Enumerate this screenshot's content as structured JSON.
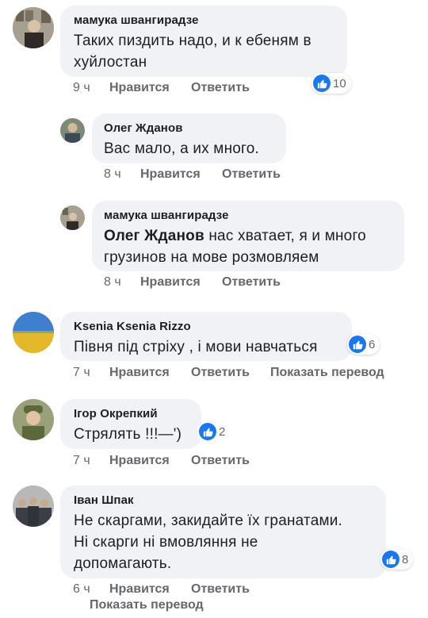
{
  "comments": [
    {
      "author": "мамука швангирадзе",
      "text": "Таких пиздить надо, и к ебеням в хуйлостан",
      "time": "9 ч",
      "like_label": "Нравится",
      "reply_label": "Ответить",
      "reactions": "10",
      "reaction_icon": "like-icon"
    },
    {
      "author": "Олег Жданов",
      "text": "Вас мало, а их много.",
      "time": "8 ч",
      "like_label": "Нравится",
      "reply_label": "Ответить"
    },
    {
      "author": "мамука швангирадзе",
      "mention": "Олег Жданов",
      "text": " нас хватает, я и много грузинов на мове  розмовляем",
      "time": "8 ч",
      "like_label": "Нравится",
      "reply_label": "Ответить"
    },
    {
      "author": "Ksenia Ksenia Rizzo",
      "text": "Півня під стріху , і мови навчаться",
      "time": "7 ч",
      "like_label": "Нравится",
      "reply_label": "Ответить",
      "translate_label": "Показать перевод",
      "reactions": "6",
      "reaction_icon": "like-icon"
    },
    {
      "author": "Ігор Окрепкий",
      "text": "Стрялять !!!—')",
      "time": "7 ч",
      "like_label": "Нравится",
      "reply_label": "Ответить",
      "reactions": "2",
      "reaction_icon": "like-icon"
    },
    {
      "author": "Іван Шпак",
      "text_lines": [
        "Не скаргами, закидайте їх гранатами.",
        "Ні скарги ні вмовляння не",
        "допомагають."
      ],
      "time": "6 ч",
      "like_label": "Нравится",
      "reply_label": "Ответить",
      "translate_label": "Показать перевод",
      "reactions": "8",
      "reaction_icon": "like-icon"
    }
  ],
  "colors": {
    "bubble": "#f0f2f5",
    "like_blue": "#1877f2",
    "meta_gray": "#65676b",
    "text": "#1c1e21"
  }
}
